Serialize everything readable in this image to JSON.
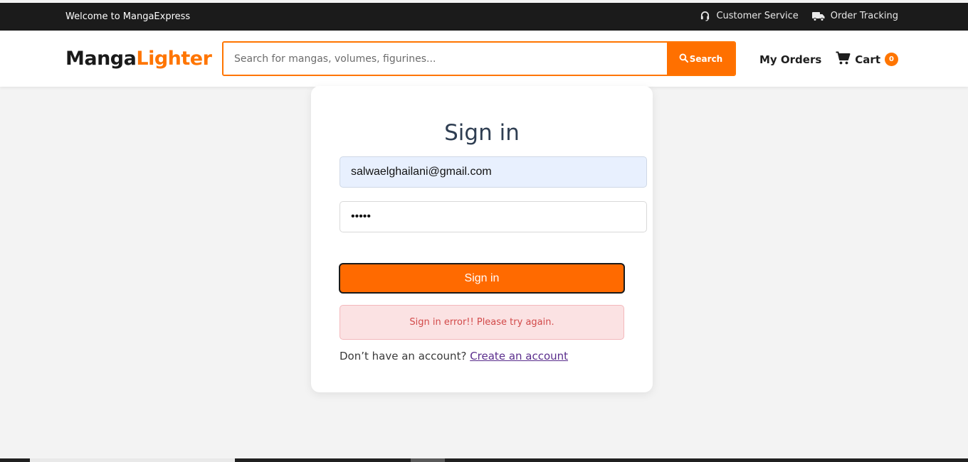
{
  "topbar": {
    "welcome": "Welcome to MangaExpress",
    "links": [
      {
        "label": "Customer Service",
        "icon": "headset-icon"
      },
      {
        "label": "Order Tracking",
        "icon": "truck-icon"
      }
    ]
  },
  "header": {
    "logo_part1": "Manga",
    "logo_part2": "Lighter",
    "search_placeholder": "Search for mangas, volumes, figurines...",
    "search_button": "Search",
    "my_orders": "My Orders",
    "cart_label": "Cart",
    "cart_count": "0"
  },
  "signin": {
    "title": "Sign in",
    "email_value": "salwaelghailani@gmail.com",
    "password_value": "•••••",
    "button_label": "Sign in",
    "error_message": "Sign in error!! Please try again.",
    "account_prompt": "Don’t have an account?",
    "create_account_link": "Create an account"
  },
  "colors": {
    "accent": "#ff7000",
    "topbar_bg": "#1b1b1b",
    "error_bg": "#fbe2e3",
    "error_text": "#d24a4a"
  }
}
